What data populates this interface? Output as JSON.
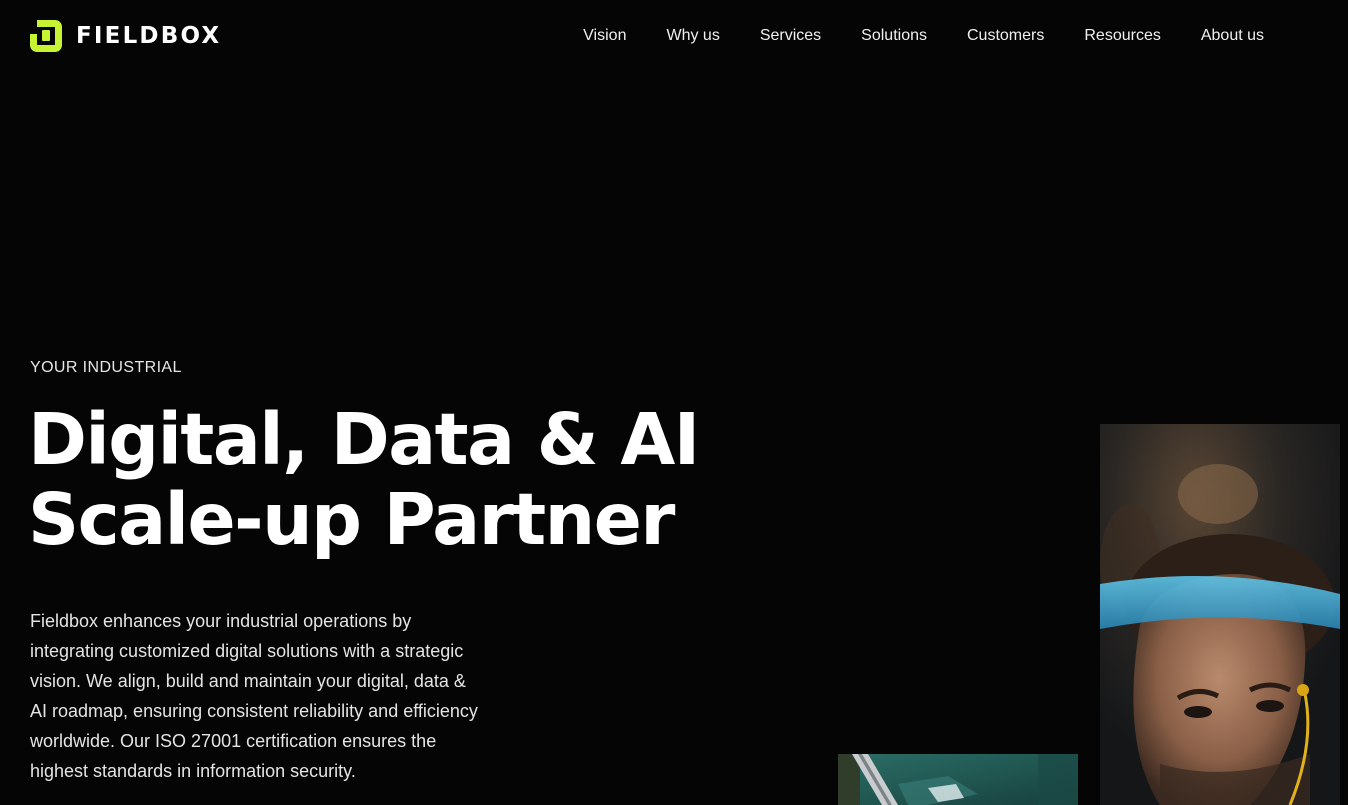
{
  "brand": {
    "name": "FIELDBOX",
    "accent_color": "#c6f432",
    "logo_icon": "fieldbox-logo-icon"
  },
  "nav": {
    "items": [
      {
        "label": "Vision"
      },
      {
        "label": "Why us"
      },
      {
        "label": "Services"
      },
      {
        "label": "Solutions"
      },
      {
        "label": "Customers"
      },
      {
        "label": "Resources"
      },
      {
        "label": "About us"
      }
    ]
  },
  "hero": {
    "eyebrow": "YOUR INDUSTRIAL",
    "title_line1": "Digital, Data & AI",
    "title_line2": "Scale-up Partner",
    "description": "Fieldbox enhances your industrial operations by integrating customized digital solutions with a strategic vision. We align, build and maintain your digital, data & AI roadmap, ensuring consistent reliability and efficiency worldwide. Our ISO 27001 certification ensures the highest standards in information security."
  },
  "images": {
    "portrait": "worker-portrait-photo",
    "aerial": "aerial-industrial-photo"
  }
}
